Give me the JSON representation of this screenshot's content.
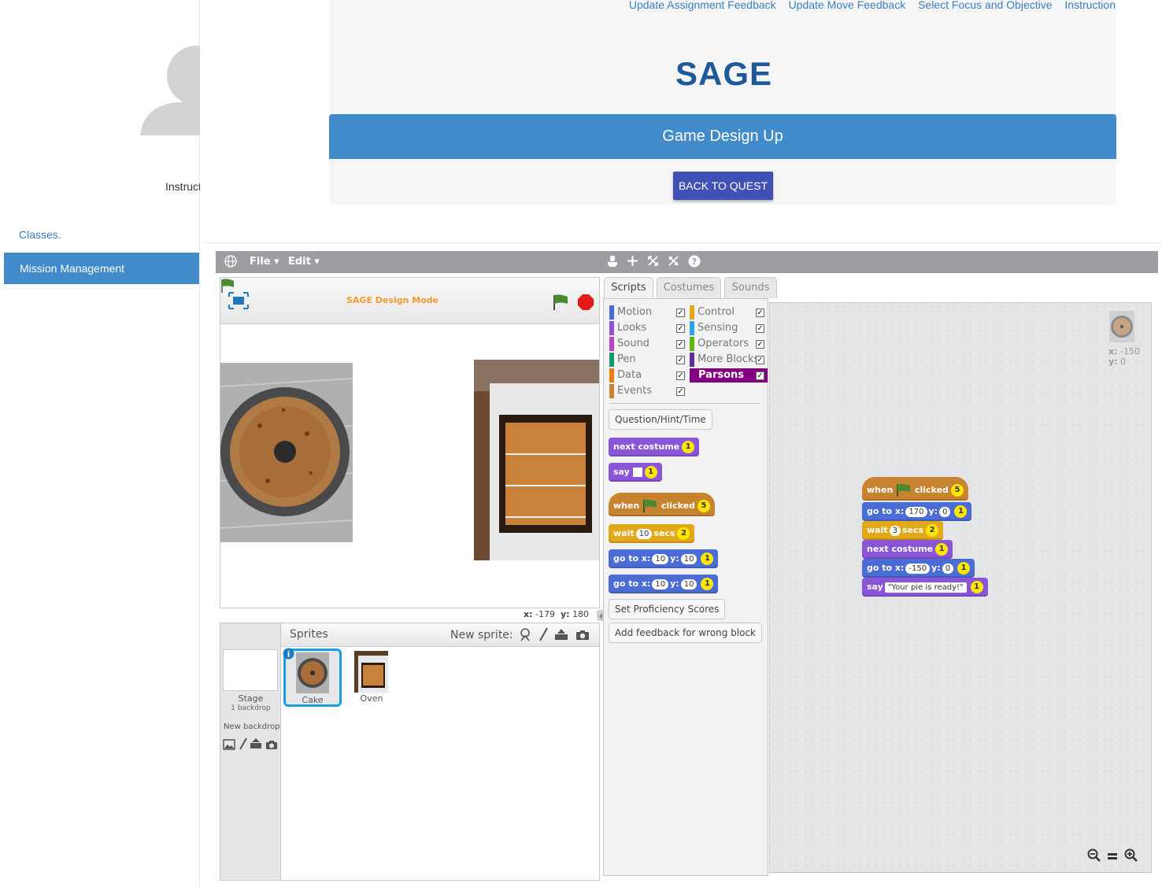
{
  "sidebar": {
    "instructor_label": "Instructor",
    "classes_link": "Classes.",
    "mission_management": "Mission Management"
  },
  "header": {
    "links": [
      "Update Assignment Feedback",
      "Update Move Feedback",
      "Select Focus and Objective",
      "Instruction"
    ],
    "logo_text": "SAGE",
    "title": "Game Design Up",
    "back_button": "BACK TO QUEST"
  },
  "editor": {
    "menu": {
      "file": "File",
      "edit": "Edit"
    },
    "stage": {
      "mode_label": "SAGE Design Mode",
      "x_label": "x:",
      "x_value": "-179",
      "y_label": "y:",
      "y_value": "180"
    },
    "sprites": {
      "header": "Sprites",
      "new_sprite_label": "New sprite:",
      "stage_label": "Stage",
      "backdrop_count": "1 backdrop",
      "new_backdrop_label": "New backdrop",
      "items": [
        {
          "name": "Cake"
        },
        {
          "name": "Oven"
        }
      ]
    },
    "tabs": [
      "Scripts",
      "Costumes",
      "Sounds"
    ],
    "categories_left": [
      "Motion",
      "Looks",
      "Sound",
      "Pen",
      "Data",
      "Events"
    ],
    "categories_right": [
      "Control",
      "Sensing",
      "Operators",
      "More Blocks",
      "Parsons"
    ],
    "category_colors": {
      "Motion": "#4a6cd4",
      "Looks": "#8a55d7",
      "Sound": "#bb42c3",
      "Pen": "#0e9a6c",
      "Data": "#ee7d16",
      "Events": "#c88330",
      "Control": "#e1a91a",
      "Sensing": "#2ca5e2",
      "Operators": "#5cb712",
      "More Blocks": "#632d99",
      "Parsons": "#800080"
    },
    "palette_buttons": {
      "question": "Question/Hint/Time",
      "proficiency": "Set Proficiency Scores",
      "feedback": "Add feedback for wrong block"
    },
    "palette_blocks": {
      "next_costume": {
        "text": "next costume",
        "points": "1"
      },
      "say": {
        "text": "say",
        "points": "1"
      },
      "when_clicked": {
        "when": "when",
        "clicked": "clicked",
        "points": "5"
      },
      "wait": {
        "wait": "wait",
        "value": "10",
        "secs": "secs",
        "points": "2"
      },
      "goto1": {
        "goto": "go to x:",
        "x": "10",
        "y_label": "y:",
        "y": "10",
        "points": "1"
      },
      "goto2": {
        "goto": "go to x:",
        "x": "10",
        "y_label": "y:",
        "y": "10",
        "points": "1"
      }
    },
    "script_blocks": {
      "when_clicked": {
        "when": "when",
        "clicked": "clicked",
        "points": "5"
      },
      "goto1": {
        "goto": "go to x:",
        "x": "170",
        "y_label": "y:",
        "y": "0",
        "points": "1"
      },
      "wait": {
        "wait": "wait",
        "value": "3",
        "secs": "secs",
        "points": "2"
      },
      "next_costume": {
        "text": "next costume",
        "points": "1"
      },
      "goto2": {
        "goto": "go to x:",
        "x": "-150",
        "y_label": "y:",
        "y": "0",
        "points": "1"
      },
      "say": {
        "say": "say",
        "value": "\"Your pie is ready!\"",
        "points": "1"
      }
    },
    "sprite_info": {
      "x_label": "x:",
      "x_value": "-150",
      "y_label": "y:",
      "y_value": "0"
    }
  }
}
